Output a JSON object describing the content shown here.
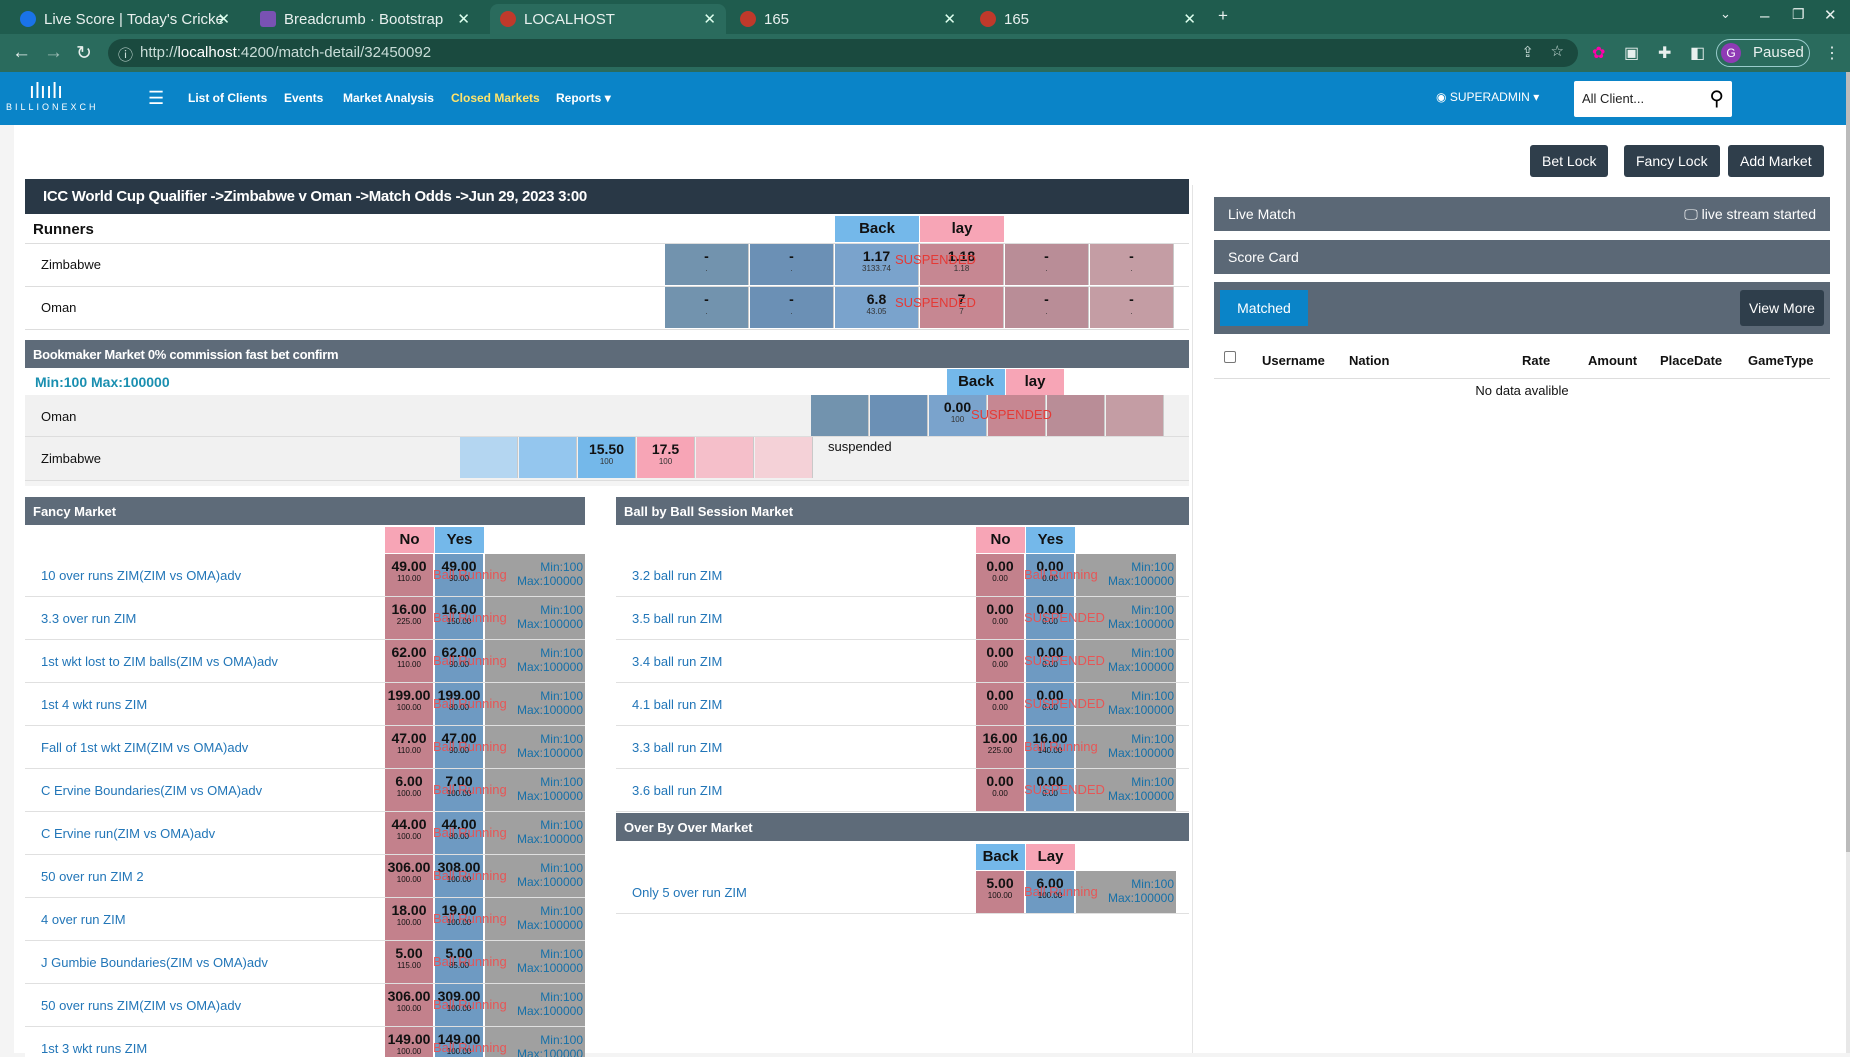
{
  "browser": {
    "tabs": [
      {
        "title": "Live Score | Today's Cricke",
        "color": "#1a73e8"
      },
      {
        "title": "Breadcrumb · Bootstrap",
        "color": "#7952b3"
      },
      {
        "title": "LOCALHOST",
        "color": "#c0392b"
      },
      {
        "title": "165",
        "color": "#c0392b"
      },
      {
        "title": "165",
        "color": "#c0392b"
      }
    ],
    "url_prefix": "http://",
    "url_host": "localhost",
    "url_rest": ":4200/match-detail/32450092",
    "paused": "Paused",
    "profile_initial": "G"
  },
  "nav": {
    "logo": "BILLIONEXCH",
    "items": [
      "List of Clients",
      "Events",
      "Market Analysis",
      "Closed Markets",
      "Reports"
    ],
    "user": "SUPERADMIN",
    "client_select": "All Client..."
  },
  "actions": {
    "bet_lock": "Bet Lock",
    "fancy_lock": "Fancy Lock",
    "add_market": "Add Market"
  },
  "match": {
    "title": "ICC World Cup Qualifier ->Zimbabwe v Oman ->Match Odds ->Jun 29, 2023 3:00",
    "runners_label": "Runners",
    "back": "Back",
    "lay": "lay",
    "suspended": "SUSPENDED",
    "dash": "-",
    "dot": ".",
    "runners": [
      {
        "name": "Zimbabwe",
        "back": "1.17",
        "back_size": "3133.74",
        "lay": "1.18",
        "lay_size": "1.18"
      },
      {
        "name": "Oman",
        "back": "6.8",
        "back_size": "43.05",
        "lay": "7",
        "lay_size": "7"
      }
    ]
  },
  "bookmaker": {
    "title": "Bookmaker Market 0% commission fast bet confirm",
    "limits": "Min:100 Max:100000",
    "back": "Back",
    "lay": "lay",
    "suspended_overlay": "SUSPENDED",
    "suspended_text": "suspended",
    "rows": [
      {
        "name": "Oman",
        "back": "0.00",
        "back_size": "100",
        "lay": "",
        "lay_size": ""
      },
      {
        "name": "Zimbabwe",
        "back": "15.50",
        "back_size": "100",
        "lay": "17.5",
        "lay_size": "100"
      }
    ]
  },
  "fancy": {
    "title": "Fancy Market",
    "no": "No",
    "yes": "Yes",
    "status": "Ball Running",
    "min": "Min:100",
    "max": "Max:100000",
    "rows": [
      {
        "name": "10 over runs ZIM(ZIM vs OMA)adv",
        "no": "49.00",
        "no_s": "110.00",
        "yes": "49.00",
        "yes_s": "90.00"
      },
      {
        "name": "3.3 over run ZIM",
        "no": "16.00",
        "no_s": "225.00",
        "yes": "16.00",
        "yes_s": "150.00"
      },
      {
        "name": "1st wkt lost to ZIM balls(ZIM vs OMA)adv",
        "no": "62.00",
        "no_s": "110.00",
        "yes": "62.00",
        "yes_s": "90.00"
      },
      {
        "name": "1st 4 wkt runs ZIM",
        "no": "199.00",
        "no_s": "100.00",
        "yes": "199.00",
        "yes_s": "80.00"
      },
      {
        "name": "Fall of 1st wkt ZIM(ZIM vs OMA)adv",
        "no": "47.00",
        "no_s": "110.00",
        "yes": "47.00",
        "yes_s": "90.00"
      },
      {
        "name": "C Ervine Boundaries(ZIM vs OMA)adv",
        "no": "6.00",
        "no_s": "100.00",
        "yes": "7.00",
        "yes_s": "100.00"
      },
      {
        "name": "C Ervine run(ZIM vs OMA)adv",
        "no": "44.00",
        "no_s": "100.00",
        "yes": "44.00",
        "yes_s": "80.00"
      },
      {
        "name": "50 over run ZIM 2",
        "no": "306.00",
        "no_s": "100.00",
        "yes": "308.00",
        "yes_s": "100.00"
      },
      {
        "name": "4 over run ZIM",
        "no": "18.00",
        "no_s": "100.00",
        "yes": "19.00",
        "yes_s": "100.00"
      },
      {
        "name": "J Gumbie Boundaries(ZIM vs OMA)adv",
        "no": "5.00",
        "no_s": "115.00",
        "yes": "5.00",
        "yes_s": "85.00"
      },
      {
        "name": "50 over runs ZIM(ZIM vs OMA)adv",
        "no": "306.00",
        "no_s": "100.00",
        "yes": "309.00",
        "yes_s": "100.00"
      },
      {
        "name": "1st 3 wkt runs ZIM",
        "no": "149.00",
        "no_s": "100.00",
        "yes": "149.00",
        "yes_s": "100.00"
      }
    ]
  },
  "ballbyball": {
    "title": "Ball by Ball Session Market",
    "no": "No",
    "yes": "Yes",
    "min": "Min:100",
    "max": "Max:100000",
    "rows": [
      {
        "name": "3.2 ball run ZIM",
        "no": "0.00",
        "no_s": "0.00",
        "yes": "0.00",
        "yes_s": "0.00",
        "status": "Ball Running"
      },
      {
        "name": "3.5 ball run ZIM",
        "no": "0.00",
        "no_s": "0.00",
        "yes": "0.00",
        "yes_s": "0.00",
        "status": "SUSPENDED"
      },
      {
        "name": "3.4 ball run ZIM",
        "no": "0.00",
        "no_s": "0.00",
        "yes": "0.00",
        "yes_s": "0.00",
        "status": "SUSPENDED"
      },
      {
        "name": "4.1 ball run ZIM",
        "no": "0.00",
        "no_s": "0.00",
        "yes": "0.00",
        "yes_s": "0.00",
        "status": "SUSPENDED"
      },
      {
        "name": "3.3 ball run ZIM",
        "no": "16.00",
        "no_s": "225.00",
        "yes": "16.00",
        "yes_s": "140.00",
        "status": "Ball Running"
      },
      {
        "name": "3.6 ball run ZIM",
        "no": "0.00",
        "no_s": "0.00",
        "yes": "0.00",
        "yes_s": "0.00",
        "status": "SUSPENDED"
      }
    ]
  },
  "overbyover": {
    "title": "Over By Over Market",
    "back": "Back",
    "lay": "Lay",
    "min": "Min:100",
    "max": "Max:100000",
    "rows": [
      {
        "name": "Only 5 over run ZIM",
        "no": "5.00",
        "no_s": "100.00",
        "yes": "6.00",
        "yes_s": "100.00",
        "status": "Ball Running"
      }
    ]
  },
  "side": {
    "live_match": "Live Match",
    "live_stream": "live stream started",
    "score_card": "Score Card",
    "matched": "Matched",
    "view_more": "View More",
    "columns": [
      "Username",
      "Nation",
      "Rate",
      "Amount",
      "PlaceDate",
      "GameType"
    ],
    "empty": "No data avalible"
  }
}
